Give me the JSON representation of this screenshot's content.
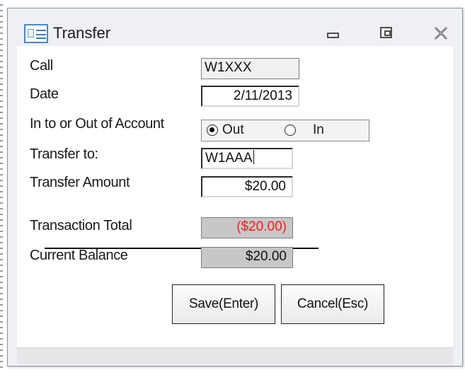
{
  "window": {
    "title": "Transfer"
  },
  "form": {
    "call": {
      "label": "Call",
      "value": "W1XXX"
    },
    "date": {
      "label": "Date",
      "value": "2/11/2013"
    },
    "direction": {
      "label": "In to or Out of Account",
      "options": [
        {
          "label": "Out",
          "selected": true
        },
        {
          "label": "In",
          "selected": false
        }
      ]
    },
    "transfer_to": {
      "label": "Transfer to:",
      "value": "W1AAA"
    },
    "transfer_amount": {
      "label": "Transfer Amount",
      "value": "$20.00"
    },
    "transaction_total": {
      "label": "Transaction Total",
      "value": "($20.00)"
    },
    "current_balance": {
      "label": "Current Balance",
      "value": "$20.00"
    }
  },
  "buttons": {
    "save": "Save(Enter)",
    "cancel": "Cancel(Esc)"
  },
  "colors": {
    "negative_value": "#ff1a1a",
    "readonly_field": "#c7c7c7",
    "icon_accent": "#3b7ac0"
  },
  "icons": {
    "title": "form-icon",
    "minimize": "minimize-icon",
    "maximize": "maximize-icon",
    "close": "close-icon"
  }
}
